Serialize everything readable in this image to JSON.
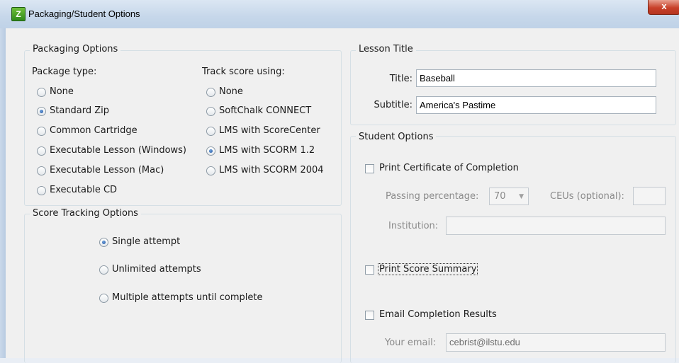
{
  "window": {
    "title": "Packaging/Student Options",
    "close_glyph": "x"
  },
  "packaging": {
    "legend": "Packaging Options",
    "package_type_label": "Package type:",
    "package_types": [
      "None",
      "Standard Zip",
      "Common Cartridge",
      "Executable Lesson (Windows)",
      "Executable Lesson (Mac)",
      "Executable CD"
    ],
    "package_selected": "Standard Zip",
    "track_label": "Track score using:",
    "track_options": [
      "None",
      "SoftChalk CONNECT",
      "LMS with ScoreCenter",
      "LMS with SCORM 1.2",
      "LMS with SCORM 2004"
    ],
    "track_selected": "LMS with SCORM 1.2"
  },
  "score_tracking": {
    "legend": "Score Tracking Options",
    "options": [
      "Single attempt",
      "Unlimited attempts",
      "Multiple attempts until complete"
    ],
    "selected": "Single attempt"
  },
  "lesson_title": {
    "legend": "Lesson Title",
    "title_label": "Title:",
    "title_value": "Baseball",
    "subtitle_label": "Subtitle:",
    "subtitle_value": "America's Pastime"
  },
  "student_options": {
    "legend": "Student Options",
    "print_certificate_label": "Print Certificate of Completion",
    "passing_label": "Passing percentage:",
    "passing_value": "70",
    "ceus_label": "CEUs (optional):",
    "ceus_value": "",
    "institution_label": "Institution:",
    "institution_value": "",
    "print_summary_label": "Print Score Summary",
    "email_label": "Email Completion Results",
    "your_email_label": "Your email:",
    "your_email_value": "cebrist@ilstu.edu"
  }
}
